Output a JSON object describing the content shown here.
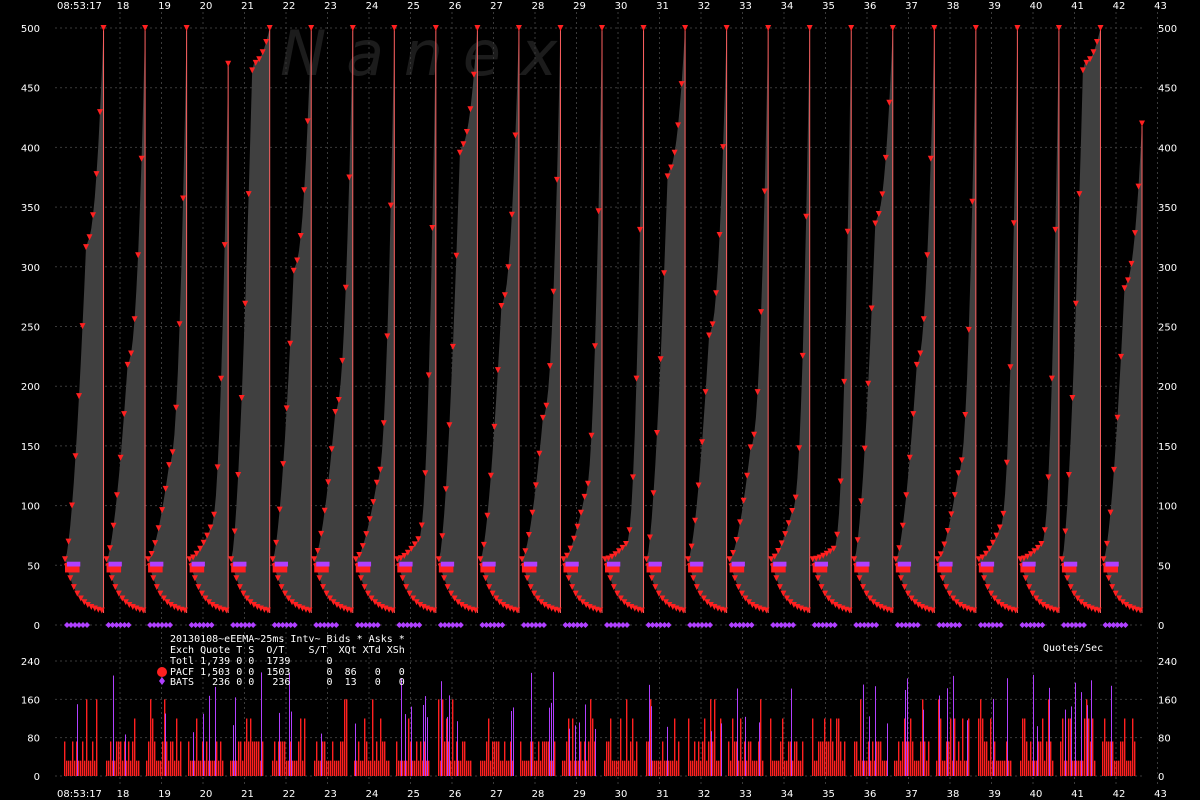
{
  "colors": {
    "background": "#000000",
    "grid": "#3a3a3a",
    "depth_fill": "#404040",
    "pacf": "#ff2020",
    "bats": "#b040ff",
    "line": "#ff6060"
  },
  "header": {
    "time_top": "08:53:17",
    "time_bottom": "08:53:17"
  },
  "watermark": "N a n e x",
  "chart_data": [
    {
      "type": "area",
      "title": "",
      "ylim": [
        0,
        500
      ],
      "yticks": [
        "0",
        "50",
        "100",
        "150",
        "200",
        "250",
        "300",
        "350",
        "400",
        "450",
        "500"
      ],
      "xticks": [
        "18",
        "19",
        "20",
        "21",
        "22",
        "23",
        "24",
        "25",
        "26",
        "27",
        "28",
        "29",
        "30",
        "31",
        "32",
        "33",
        "34",
        "35",
        "36",
        "37",
        "38",
        "39",
        "40",
        "41",
        "42",
        "43"
      ],
      "series": [
        {
          "name": "PACF",
          "peaks": [
            500,
            500,
            500,
            470,
            500,
            500,
            500,
            500,
            500,
            500,
            500,
            500,
            500,
            500,
            500,
            500,
            500,
            500,
            500,
            500,
            500,
            500,
            500,
            500,
            500,
            420
          ],
          "plateau": [
            320,
            220,
            135,
            82,
            470,
            300,
            180,
            120,
            72,
            400,
            270,
            175,
            108,
            68,
            380,
            245,
            150,
            96,
            64,
            340,
            220,
            128,
            82,
            68,
            470,
            285
          ]
        },
        {
          "name": "BATS",
          "level": 50
        }
      ]
    },
    {
      "type": "bar",
      "ylim": [
        0,
        240
      ],
      "yticks": [
        "0",
        "80",
        "160",
        "240"
      ],
      "ylabel": "Quotes/Sec",
      "legend": {
        "title": "20130108~eEEMA~25ms Intv~ Bids * Asks *",
        "header": "Exch Quote T S  O/T    S/T  XQt XTd XSh",
        "rows": [
          {
            "name": "Totl",
            "text": "Totl 1,739 0 0  1739      0"
          },
          {
            "name": "PACF",
            "text": "PACF 1,503 0 0  1503      0  86   0   0"
          },
          {
            "name": "BATS",
            "text": "BATS   236 0 0   236      0  13   0   0"
          }
        ]
      }
    }
  ]
}
